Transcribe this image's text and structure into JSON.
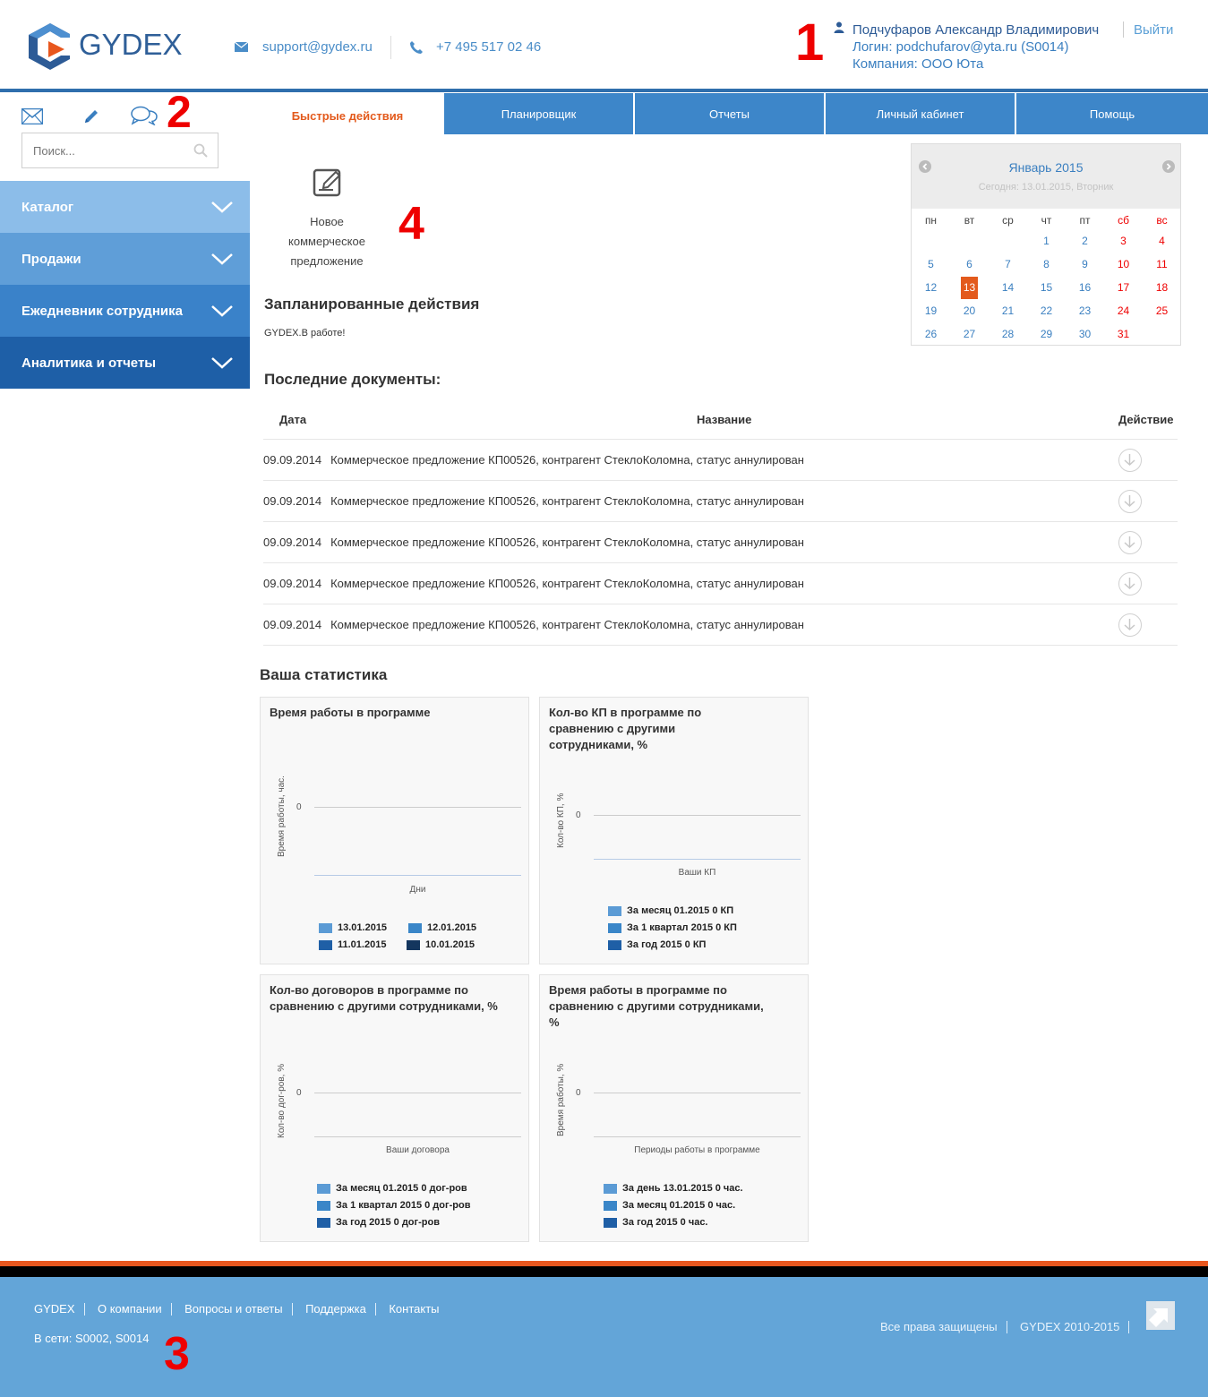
{
  "header": {
    "logo_text": "GYDEX",
    "email": "support@gydex.ru",
    "phone": "+7 495 517 02 46",
    "user_name": "Подчуфаров Александр Владимирович",
    "logout": "Выйти",
    "login_line": "Логин: podchufarov@yta.ru (S0014)",
    "company_line": "Компания: ООО Юта"
  },
  "annotations": [
    "1",
    "2",
    "3",
    "4"
  ],
  "sidebar": {
    "search_placeholder": "Поиск...",
    "items": [
      {
        "label": "Каталог",
        "color": "#8cbde9"
      },
      {
        "label": "Продажи",
        "color": "#5f9ed8"
      },
      {
        "label": "Ежедневник сотрудника",
        "color": "#3a82c9"
      },
      {
        "label": "Аналитика и отчеты",
        "color": "#1e5fa7"
      }
    ]
  },
  "tabs": [
    "Быстрые действия",
    "Планировщик",
    "Отчеты",
    "Личный кабинет",
    "Помощь"
  ],
  "quick_action": {
    "line1": "Новое",
    "line2": "коммерческое",
    "line3": "предложение"
  },
  "planned": {
    "title": "Запланированные действия",
    "text": "GYDEX.В работе!"
  },
  "calendar": {
    "month": "Январь 2015",
    "today": "Сегодня: 13.01.2015, Вторник",
    "weekdays": [
      "пн",
      "вт",
      "ср",
      "чт",
      "пт",
      "сб",
      "вс"
    ],
    "weeks": [
      [
        "",
        "",
        "",
        "1",
        "2",
        "3",
        "4"
      ],
      [
        "5",
        "6",
        "7",
        "8",
        "9",
        "10",
        "11"
      ],
      [
        "12",
        "13",
        "14",
        "15",
        "16",
        "17",
        "18"
      ],
      [
        "19",
        "20",
        "21",
        "22",
        "23",
        "24",
        "25"
      ],
      [
        "26",
        "27",
        "28",
        "29",
        "30",
        "31",
        ""
      ]
    ],
    "selected": "13"
  },
  "docs": {
    "title": "Последние документы:",
    "col_date": "Дата",
    "col_name": "Название",
    "col_action": "Действие",
    "rows": [
      {
        "date": "09.09.2014",
        "name": "Коммерческое предложение КП00526, контрагент СтеклоКоломна, статус аннулирован"
      },
      {
        "date": "09.09.2014",
        "name": "Коммерческое предложение КП00526, контрагент СтеклоКоломна, статус аннулирован"
      },
      {
        "date": "09.09.2014",
        "name": "Коммерческое предложение КП00526, контрагент СтеклоКоломна, статус аннулирован"
      },
      {
        "date": "09.09.2014",
        "name": "Коммерческое предложение КП00526, контрагент СтеклоКоломна, статус аннулирован"
      },
      {
        "date": "09.09.2014",
        "name": "Коммерческое предложение КП00526, контрагент СтеклоКоломна, статус аннулирован"
      }
    ]
  },
  "stats": {
    "title": "Ваша статистика",
    "charts": [
      {
        "title": "Время работы в программе",
        "ylabel": "Время работы, час.",
        "xlabel": "Дни",
        "zero": "0",
        "legend": [
          {
            "label": "13.01.2015",
            "color": "#5b9bd5"
          },
          {
            "label": "12.01.2015",
            "color": "#3a86c8"
          },
          {
            "label": "11.01.2015",
            "color": "#1f5fa6"
          },
          {
            "label": "10.01.2015",
            "color": "#14365e"
          }
        ]
      },
      {
        "title": "Кол-во КП в программе по сравнению с другими сотрудниками, %",
        "ylabel": "Кол-во КП, %",
        "xlabel": "Ваши КП",
        "zero": "0",
        "legend": [
          {
            "label": "За месяц 01.2015 0 КП",
            "color": "#5b9bd5"
          },
          {
            "label": "За 1 квартал 2015 0 КП",
            "color": "#3a86c8"
          },
          {
            "label": "За год 2015 0 КП",
            "color": "#1f5fa6"
          }
        ]
      },
      {
        "title": "Кол-во договоров в программе по сравнению с другими сотрудниками, %",
        "ylabel": "Кол-во дог-ров, %",
        "xlabel": "Ваши договора",
        "zero": "0",
        "legend": [
          {
            "label": "За месяц 01.2015 0 дог-ров",
            "color": "#5b9bd5"
          },
          {
            "label": "За 1 квартал 2015 0 дог-ров",
            "color": "#3a86c8"
          },
          {
            "label": "За год 2015 0 дог-ров",
            "color": "#1f5fa6"
          }
        ]
      },
      {
        "title": "Время работы в программе по сравнению с другими сотрудниками, %",
        "ylabel": "Время работы, %",
        "xlabel": "Периоды работы в программе",
        "zero": "0",
        "legend": [
          {
            "label": "За день 13.01.2015 0 час.",
            "color": "#5b9bd5"
          },
          {
            "label": "За месяц 01.2015 0 час.",
            "color": "#3a86c8"
          },
          {
            "label": "За год 2015 0 час.",
            "color": "#1f5fa6"
          }
        ]
      }
    ]
  },
  "footer": {
    "links": [
      "GYDEX",
      "О компании",
      "Вопросы и ответы",
      "Поддержка",
      "Контакты"
    ],
    "online": "В сети: S0002, S0014",
    "rights": "Все права защищены",
    "copyright": "GYDEX 2010-2015"
  },
  "colors": {
    "accent": "#e35a1c",
    "brand": "#3d86c9",
    "footer": "#63a5d8"
  }
}
